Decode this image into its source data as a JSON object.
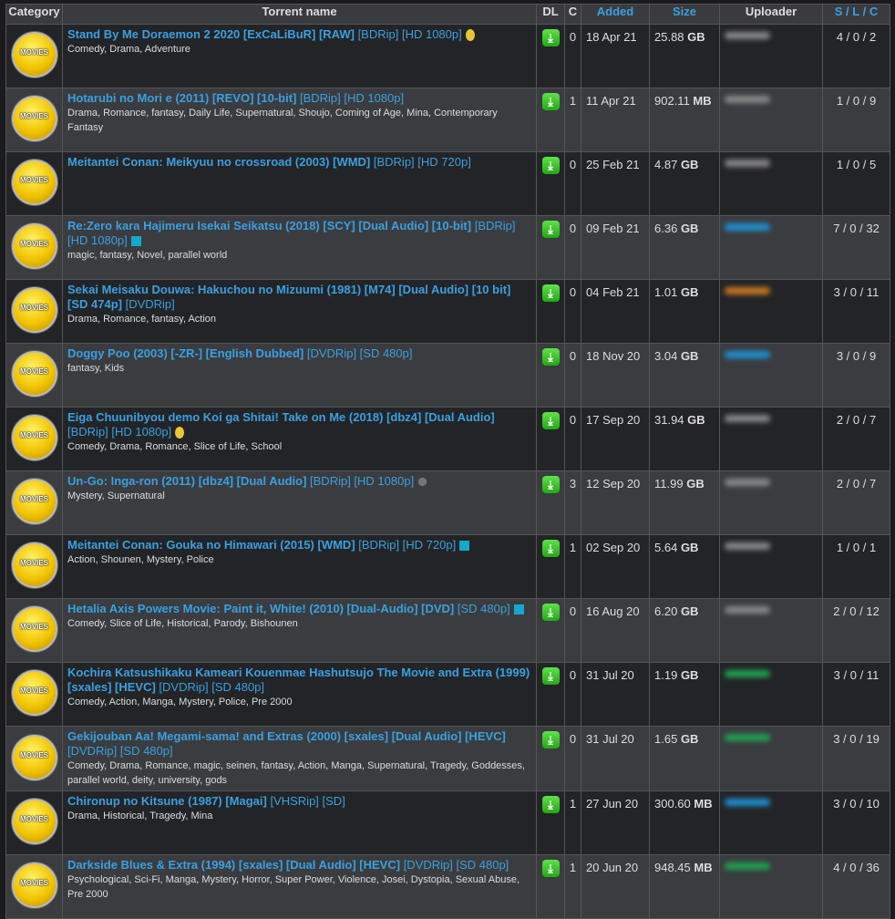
{
  "headers": {
    "category": "Category",
    "name": "Torrent name",
    "dl": "DL",
    "c": "C",
    "added": "Added",
    "size": "Size",
    "uploader": "Uploader",
    "s": "S",
    "l": "L",
    "cc": "C",
    "sep": " / "
  },
  "category_label": "MOVIES",
  "rows": [
    {
      "title": "Stand By Me Doraemon 2 2020 [ExCaLiBuR] [RAW]",
      "extra": " [BDRip] [HD 1080p]",
      "icon": "coin",
      "tags": "Comedy, Drama, Adventure",
      "c": "0",
      "added": "18 Apr 21",
      "size_num": "25.88",
      "size_unit": "GB",
      "uploader_color": "#888888",
      "slc": "4 / 0 / 2"
    },
    {
      "title": "Hotarubi no Mori e (2011) [REVO] [10-bit]",
      "extra": " [BDRip] [HD 1080p]",
      "icon": "",
      "tags": "Drama, Romance, fantasy, Daily Life, Supernatural, Shoujo, Coming of Age, Mina, Contemporary Fantasy",
      "c": "1",
      "added": "11 Apr 21",
      "size_num": "902.11",
      "size_unit": "MB",
      "uploader_color": "#888888",
      "slc": "1 / 0 / 9"
    },
    {
      "title": "Meitantei Conan: Meikyuu no crossroad (2003) [WMD]",
      "extra": " [BDRip] [HD 720p]",
      "icon": "",
      "tags": "",
      "c": "0",
      "added": "25 Feb 21",
      "size_num": "4.87",
      "size_unit": "GB",
      "uploader_color": "#888888",
      "slc": "1 / 0 / 5"
    },
    {
      "title": "Re:Zero kara Hajimeru Isekai Seikatsu (2018) [SCY] [Dual Audio] [10-bit]",
      "extra": " [BDRip] [HD 1080p]",
      "icon": "square",
      "tags": "magic, fantasy, Novel, parallel world",
      "c": "0",
      "added": "09 Feb 21",
      "size_num": "6.36",
      "size_unit": "GB",
      "uploader_color": "#1e90d0",
      "slc": "7 / 0 / 32"
    },
    {
      "title": "Sekai Meisaku Douwa: Hakuchou no Mizuumi (1981) [M74] [Dual Audio] [10 bit] [SD 474p]",
      "extra": " [DVDRip]",
      "icon": "",
      "tags": "Drama, Romance, fantasy, Action",
      "c": "0",
      "added": "04 Feb 21",
      "size_num": "1.01",
      "size_unit": "GB",
      "uploader_color": "#c87820",
      "slc": "3 / 0 / 11"
    },
    {
      "title": "Doggy Poo (2003) [-ZR-] [English Dubbed]",
      "extra": " [DVDRip] [SD 480p]",
      "icon": "",
      "tags": "fantasy, Kids",
      "c": "0",
      "added": "18 Nov 20",
      "size_num": "3.04",
      "size_unit": "GB",
      "uploader_color": "#1e90d0",
      "slc": "3 / 0 / 9"
    },
    {
      "title": "Eiga Chuunibyou demo Koi ga Shitai! Take on Me (2018) [dbz4] [Dual Audio]",
      "extra": " [BDRip] [HD 1080p]",
      "icon": "coin",
      "tags": "Comedy, Drama, Romance, Slice of Life, School",
      "c": "0",
      "added": "17 Sep 20",
      "size_num": "31.94",
      "size_unit": "GB",
      "uploader_color": "#888888",
      "slc": "2 / 0 / 7"
    },
    {
      "title": "Un-Go: Inga-ron (2011) [dbz4] [Dual Audio]",
      "extra": " [BDRip] [HD 1080p]",
      "icon": "dot",
      "tags": "Mystery, Supernatural",
      "c": "3",
      "added": "12 Sep 20",
      "size_num": "11.99",
      "size_unit": "GB",
      "uploader_color": "#888888",
      "slc": "2 / 0 / 7"
    },
    {
      "title": "Meitantei Conan: Gouka no Himawari (2015) [WMD]",
      "extra": " [BDRip] [HD 720p]",
      "icon": "square",
      "tags": "Action, Shounen, Mystery, Police",
      "c": "1",
      "added": "02 Sep 20",
      "size_num": "5.64",
      "size_unit": "GB",
      "uploader_color": "#888888",
      "slc": "1 / 0 / 1"
    },
    {
      "title": "Hetalia Axis Powers Movie: Paint it, White! (2010) [Dual-Audio] [DVD]",
      "extra": " [SD 480p]",
      "icon": "square",
      "tags": "Comedy, Slice of Life, Historical, Parody, Bishounen",
      "c": "0",
      "added": "16 Aug 20",
      "size_num": "6.20",
      "size_unit": "GB",
      "uploader_color": "#888888",
      "slc": "2 / 0 / 12"
    },
    {
      "title": "Kochira Katsushikaku Kameari Kouenmae Hashutsujo The Movie and Extra (1999) [sxales] [HEVC]",
      "extra": " [DVDRip] [SD 480p]",
      "icon": "",
      "tags": "Comedy, Action, Manga, Mystery, Police, Pre 2000",
      "c": "0",
      "added": "31 Jul 20",
      "size_num": "1.19",
      "size_unit": "GB",
      "uploader_color": "#20a050",
      "slc": "3 / 0 / 11"
    },
    {
      "title": "Gekijouban Aa! Megami-sama! and Extras (2000) [sxales] [Dual Audio] [HEVC]",
      "extra": " [DVDRip] [SD 480p]",
      "icon": "",
      "tags": "Comedy, Drama, Romance, magic, seinen, fantasy, Action, Manga, Supernatural, Tragedy, Goddesses, parallel world, deity, university, gods",
      "c": "0",
      "added": "31 Jul 20",
      "size_num": "1.65",
      "size_unit": "GB",
      "uploader_color": "#20a050",
      "slc": "3 / 0 / 19"
    },
    {
      "title": "Chironup no Kitsune (1987) [Magai]",
      "extra": " [VHSRip] [SD]",
      "icon": "",
      "tags": "Drama, Historical, Tragedy, Mina",
      "c": "1",
      "added": "27 Jun 20",
      "size_num": "300.60",
      "size_unit": "MB",
      "uploader_color": "#1e90d0",
      "slc": "3 / 0 / 10"
    },
    {
      "title": "Darkside Blues & Extra (1994) [sxales] [Dual Audio] [HEVC]",
      "extra": " [DVDRip] [SD 480p]",
      "icon": "",
      "tags": "Psychological, Sci-Fi, Manga, Mystery, Horror, Super Power, Violence, Josei, Dystopia, Sexual Abuse, Pre 2000",
      "c": "1",
      "added": "20 Jun 20",
      "size_num": "948.45",
      "size_unit": "MB",
      "uploader_color": "#20a050",
      "slc": "4 / 0 / 36"
    }
  ]
}
